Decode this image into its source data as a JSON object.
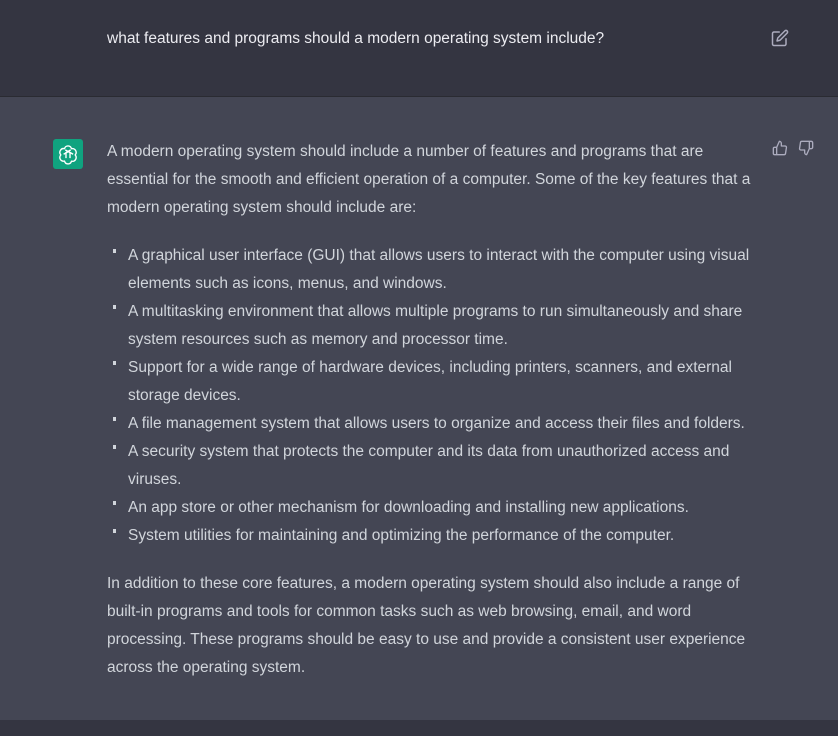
{
  "user_message": {
    "text": "what features and programs should a modern operating system include?"
  },
  "assistant_message": {
    "intro": "A modern operating system should include a number of features and programs that are essential for the smooth and efficient operation of a computer. Some of the key features that a modern operating system should include are:",
    "features": [
      "A graphical user interface (GUI) that allows users to interact with the computer using visual elements such as icons, menus, and windows.",
      "A multitasking environment that allows multiple programs to run simultaneously and share system resources such as memory and processor time.",
      "Support for a wide range of hardware devices, including printers, scanners, and external storage devices.",
      "A file management system that allows users to organize and access their files and folders.",
      "A security system that protects the computer and its data from unauthorized access and viruses.",
      "An app store or other mechanism for downloading and installing new applications.",
      "System utilities for maintaining and optimizing the performance of the computer."
    ],
    "conclusion": "In addition to these core features, a modern operating system should also include a range of built-in programs and tools for common tasks such as web browsing, email, and word processing. These programs should be easy to use and provide a consistent user experience across the operating system."
  },
  "icons": {
    "edit": "edit-icon",
    "avatar": "openai-logo-icon",
    "thumbs_up": "thumbs-up-icon",
    "thumbs_down": "thumbs-down-icon"
  },
  "colors": {
    "user_background": "#343541",
    "assistant_background": "#444654",
    "avatar_background": "#10a37f",
    "text": "#d1d5db",
    "icon": "#acacbe"
  }
}
